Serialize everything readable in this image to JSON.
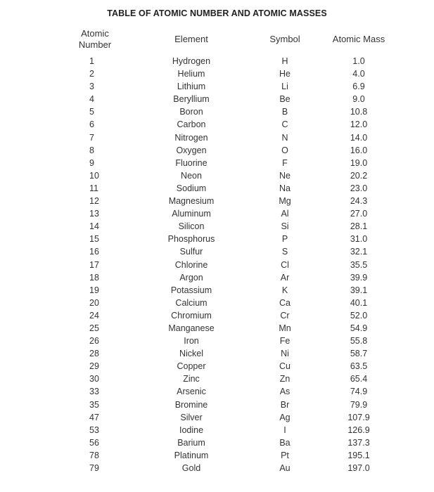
{
  "title": "TABLE OF ATOMIC NUMBER AND ATOMIC MASSES",
  "headers": {
    "atomic_number_line1": "Atomic",
    "atomic_number_line2": "Number",
    "element": "Element",
    "symbol": "Symbol",
    "atomic_mass": "Atomic Mass"
  },
  "rows": [
    {
      "number": "1",
      "element": "Hydrogen",
      "symbol": "H",
      "mass": "1.0"
    },
    {
      "number": "2",
      "element": "Helium",
      "symbol": "He",
      "mass": "4.0"
    },
    {
      "number": "3",
      "element": "Lithium",
      "symbol": "Li",
      "mass": "6.9"
    },
    {
      "number": "4",
      "element": "Beryllium",
      "symbol": "Be",
      "mass": "9.0"
    },
    {
      "number": "5",
      "element": "Boron",
      "symbol": "B",
      "mass": "10.8"
    },
    {
      "number": "6",
      "element": "Carbon",
      "symbol": "C",
      "mass": "12.0"
    },
    {
      "number": "7",
      "element": "Nitrogen",
      "symbol": "N",
      "mass": "14.0"
    },
    {
      "number": "8",
      "element": "Oxygen",
      "symbol": "O",
      "mass": "16.0"
    },
    {
      "number": "9",
      "element": "Fluorine",
      "symbol": "F",
      "mass": "19.0"
    },
    {
      "number": "10",
      "element": "Neon",
      "symbol": "Ne",
      "mass": "20.2"
    },
    {
      "number": "11",
      "element": "Sodium",
      "symbol": "Na",
      "mass": "23.0"
    },
    {
      "number": "12",
      "element": "Magnesium",
      "symbol": "Mg",
      "mass": "24.3"
    },
    {
      "number": "13",
      "element": "Aluminum",
      "symbol": "Al",
      "mass": "27.0"
    },
    {
      "number": "14",
      "element": "Silicon",
      "symbol": "Si",
      "mass": "28.1"
    },
    {
      "number": "15",
      "element": "Phosphorus",
      "symbol": "P",
      "mass": "31.0"
    },
    {
      "number": "16",
      "element": "Sulfur",
      "symbol": "S",
      "mass": "32.1"
    },
    {
      "number": "17",
      "element": "Chlorine",
      "symbol": "Cl",
      "mass": "35.5"
    },
    {
      "number": "18",
      "element": "Argon",
      "symbol": "Ar",
      "mass": "39.9"
    },
    {
      "number": "19",
      "element": "Potassium",
      "symbol": "K",
      "mass": "39.1"
    },
    {
      "number": "20",
      "element": "Calcium",
      "symbol": "Ca",
      "mass": "40.1"
    },
    {
      "number": "24",
      "element": "Chromium",
      "symbol": "Cr",
      "mass": "52.0"
    },
    {
      "number": "25",
      "element": "Manganese",
      "symbol": "Mn",
      "mass": "54.9"
    },
    {
      "number": "26",
      "element": "Iron",
      "symbol": "Fe",
      "mass": "55.8"
    },
    {
      "number": "28",
      "element": "Nickel",
      "symbol": "Ni",
      "mass": "58.7"
    },
    {
      "number": "29",
      "element": "Copper",
      "symbol": "Cu",
      "mass": "63.5"
    },
    {
      "number": "30",
      "element": "Zinc",
      "symbol": "Zn",
      "mass": "65.4"
    },
    {
      "number": "33",
      "element": "Arsenic",
      "symbol": "As",
      "mass": "74.9"
    },
    {
      "number": "35",
      "element": "Bromine",
      "symbol": "Br",
      "mass": "79.9"
    },
    {
      "number": "47",
      "element": "Silver",
      "symbol": "Ag",
      "mass": "107.9"
    },
    {
      "number": "53",
      "element": "Iodine",
      "symbol": "I",
      "mass": "126.9"
    },
    {
      "number": "56",
      "element": "Barium",
      "symbol": "Ba",
      "mass": "137.3"
    },
    {
      "number": "78",
      "element": "Platinum",
      "symbol": "Pt",
      "mass": "195.1"
    },
    {
      "number": "79",
      "element": "Gold",
      "symbol": "Au",
      "mass": "197.0"
    }
  ]
}
